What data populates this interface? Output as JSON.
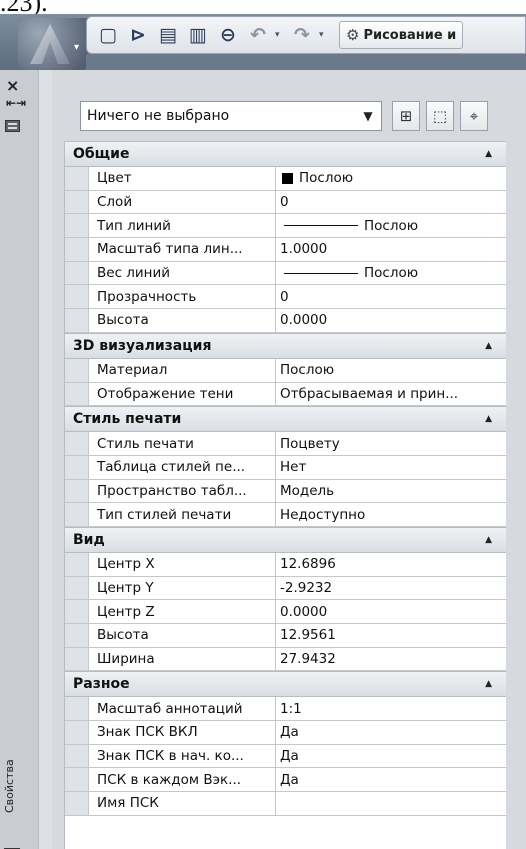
{
  "caption": ".23).",
  "toolbar": {
    "icons": [
      "new-icon",
      "open-icon",
      "save-icon",
      "save-as-icon",
      "print-icon",
      "undo-icon",
      "redo-icon"
    ],
    "workspace": "Рисование и"
  },
  "side": {
    "label": "Свойства"
  },
  "selector": {
    "value": "Ничего не выбрано"
  },
  "categories": [
    {
      "title": "Общие",
      "rows": [
        {
          "name": "Цвет",
          "value": "Послою",
          "kind": "color"
        },
        {
          "name": "Слой",
          "value": "0"
        },
        {
          "name": "Тип линий",
          "value": "Послою",
          "kind": "line"
        },
        {
          "name": "Масштаб типа лин...",
          "value": "1.0000"
        },
        {
          "name": "Вес линий",
          "value": "Послою",
          "kind": "line"
        },
        {
          "name": "Прозрачность",
          "value": "0"
        },
        {
          "name": "Высота",
          "value": "0.0000"
        }
      ]
    },
    {
      "title": "3D визуализация",
      "rows": [
        {
          "name": "Материал",
          "value": "Послою"
        },
        {
          "name": "Отображение тени",
          "value": "Отбрасываемая и прин..."
        }
      ]
    },
    {
      "title": "Стиль печати",
      "rows": [
        {
          "name": "Стиль печати",
          "value": "Поцвету"
        },
        {
          "name": "Таблица стилей пе...",
          "value": "Нет"
        },
        {
          "name": "Пространство табл...",
          "value": "Модель"
        },
        {
          "name": "Тип стилей печати",
          "value": "Недоступно"
        }
      ]
    },
    {
      "title": "Вид",
      "rows": [
        {
          "name": "Центр X",
          "value": "12.6896"
        },
        {
          "name": "Центр Y",
          "value": "-2.9232"
        },
        {
          "name": "Центр Z",
          "value": "0.0000"
        },
        {
          "name": "Высота",
          "value": "12.9561"
        },
        {
          "name": "Ширина",
          "value": "27.9432"
        }
      ]
    },
    {
      "title": "Разное",
      "rows": [
        {
          "name": "Масштаб аннотаций",
          "value": "1:1"
        },
        {
          "name": "Знак ПСК ВКЛ",
          "value": "Да"
        },
        {
          "name": "Знак ПСК в нач. ко...",
          "value": "Да"
        },
        {
          "name": "ПСК в каждом Вэк...",
          "value": "Да"
        },
        {
          "name": "Имя ПСК",
          "value": ""
        }
      ]
    }
  ]
}
